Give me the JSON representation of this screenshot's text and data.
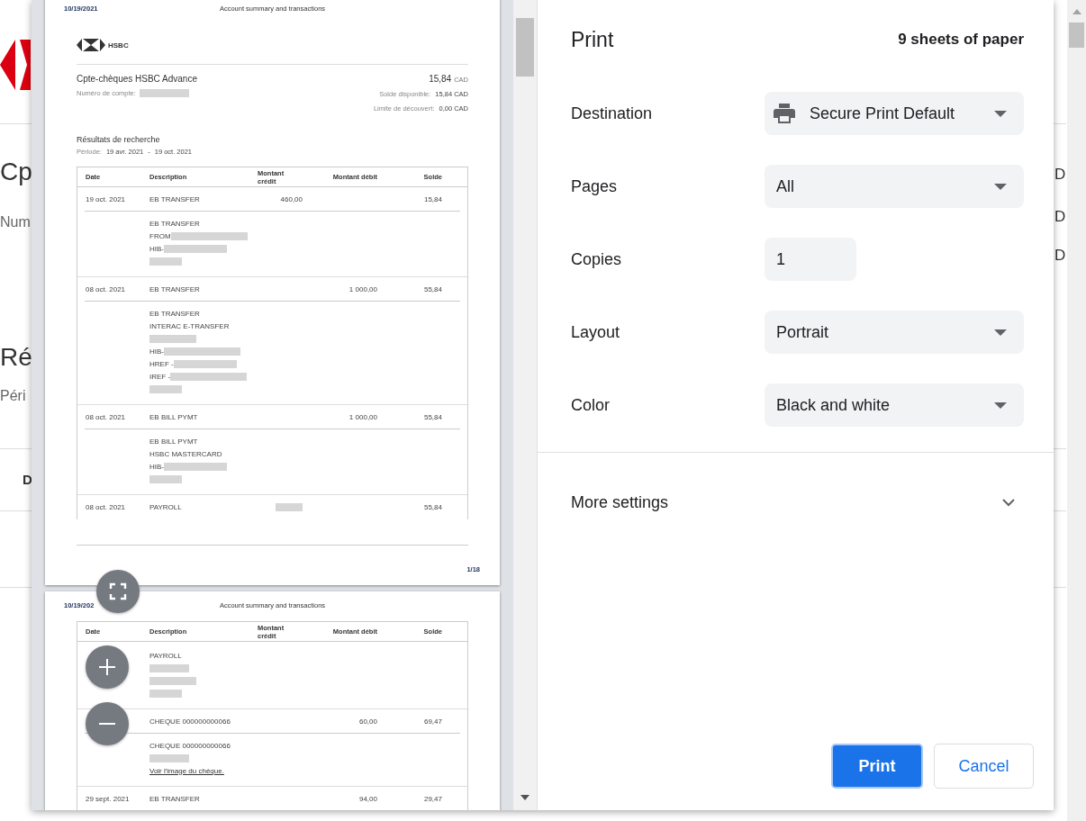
{
  "background_page": {
    "left_texts": [
      {
        "text": "Cp",
        "kind": "title"
      },
      {
        "text": "Num",
        "kind": "sub"
      },
      {
        "text": "Ré",
        "kind": "title"
      },
      {
        "text": "Péri",
        "kind": "sub"
      },
      {
        "text": "D",
        "kind": "head"
      }
    ],
    "right_texts": [
      "D",
      "D",
      "D"
    ]
  },
  "preview": {
    "pages": [
      {
        "date": "10/19/2021",
        "header": "Account summary and transactions",
        "logo_text": "HSBC",
        "account": {
          "name": "Cpte-chèques HSBC Advance",
          "amount": "15,84",
          "currency": "CAD",
          "number_label": "Numéro de compte:",
          "available_label": "Solde disponible:",
          "available": "15,84 CAD",
          "overdraft_label": "Limite de découvert:",
          "overdraft": "0,00 CAD"
        },
        "results_title": "Résultats de recherche",
        "period_label": "Période:",
        "period_from": "19 avr. 2021",
        "period_sep": "-",
        "period_to": "19 oct. 2021",
        "columns": [
          "Date",
          "Description",
          "Montant crédit",
          "Montant débit",
          "Solde"
        ],
        "rows": [
          {
            "kind": "entry",
            "date": "19 oct. 2021",
            "description": "EB TRANSFER",
            "credit": "460,00",
            "balance": "15,84",
            "details": [
              {
                "text": "EB TRANSFER"
              },
              {
                "text": "FROM",
                "blurred": true
              },
              {
                "text": "HIB-",
                "blurred": true
              },
              {
                "blurred": true
              }
            ]
          },
          {
            "kind": "entry",
            "date": "08 oct. 2021",
            "description": "EB TRANSFER",
            "debit": "1 000,00",
            "balance": "55,84",
            "details": [
              {
                "text": "EB TRANSFER"
              },
              {
                "text": "INTERAC E-TRANSFER"
              },
              {
                "blurred": true
              },
              {
                "text": "HIB-",
                "blurred": true
              },
              {
                "text": "HREF -",
                "blurred": true
              },
              {
                "text": "IREF -",
                "blurred": true
              },
              {
                "blurred": true
              }
            ]
          },
          {
            "kind": "entry",
            "date": "08 oct. 2021",
            "description": "EB BILL PYMT",
            "debit": "1 000,00",
            "balance": "55,84",
            "details": [
              {
                "text": "EB BILL PYMT"
              },
              {
                "text": "HSBC MASTERCARD"
              },
              {
                "text": "HIB-",
                "blurred": true
              },
              {
                "blurred": true
              }
            ]
          },
          {
            "kind": "cut",
            "date": "08 oct. 2021",
            "description": "PAYROLL",
            "credit_blurred": true,
            "balance": "55,84"
          }
        ],
        "page_number": "1/18"
      },
      {
        "date": "10/19/202",
        "header": "Account summary and transactions",
        "columns": [
          "Date",
          "Description",
          "Montant crédit",
          "Montant débit",
          "Solde"
        ],
        "rows": [
          {
            "kind": "continued",
            "details": [
              {
                "text": "PAYROLL"
              },
              {
                "blurred": true
              },
              {
                "blurred": true
              },
              {
                "blurred": true
              }
            ]
          },
          {
            "kind": "entry",
            "description": "CHEQUE 000000000066",
            "debit": "60,00",
            "balance": "69,47",
            "details": [
              {
                "text": "CHEQUE 000000000066"
              },
              {
                "blurred": true
              },
              {
                "link": "Voir l'image du chèque."
              }
            ]
          },
          {
            "kind": "entry",
            "date": "29 sept. 2021",
            "description": "EB TRANSFER",
            "debit": "94,00",
            "balance": "29,47",
            "details": []
          }
        ]
      }
    ]
  },
  "settings": {
    "title": "Print",
    "sheets": "9 sheets of paper",
    "fields": [
      {
        "label": "Destination",
        "kind": "select",
        "value": "Secure Print Default"
      },
      {
        "label": "Pages",
        "kind": "select",
        "value": "All"
      },
      {
        "label": "Copies",
        "kind": "number",
        "value": "1"
      },
      {
        "label": "Layout",
        "kind": "select",
        "value": "Portrait"
      },
      {
        "label": "Color",
        "kind": "select",
        "value": "Black and white"
      }
    ],
    "more_settings": {
      "label": "More settings",
      "expanded": false
    },
    "buttons": [
      {
        "label": "Print",
        "kind": "primary"
      },
      {
        "label": "Cancel",
        "kind": "secondary"
      }
    ]
  }
}
